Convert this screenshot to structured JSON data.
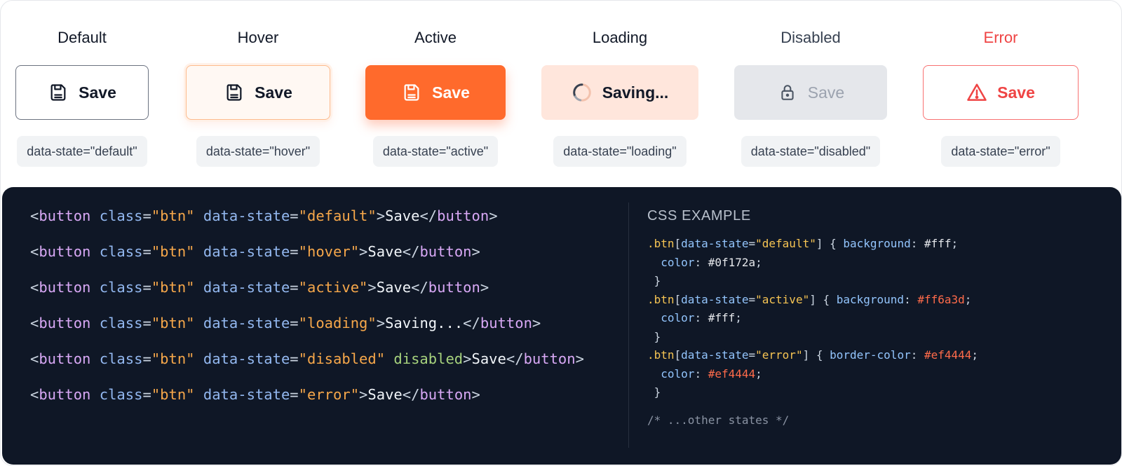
{
  "states": [
    {
      "key": "default",
      "title": "Default",
      "label": "Save",
      "chip": "data-state=\"default\"",
      "icon": "save-icon"
    },
    {
      "key": "hover",
      "title": "Hover",
      "label": "Save",
      "chip": "data-state=\"hover\"",
      "icon": "save-icon"
    },
    {
      "key": "active",
      "title": "Active",
      "label": "Save",
      "chip": "data-state=\"active\"",
      "icon": "save-icon"
    },
    {
      "key": "loading",
      "title": "Loading",
      "label": "Saving...",
      "chip": "data-state=\"loading\"",
      "icon": "spinner-icon"
    },
    {
      "key": "disabled",
      "title": "Disabled",
      "label": "Save",
      "chip": "data-state=\"disabled\"",
      "icon": "lock-icon"
    },
    {
      "key": "error",
      "title": "Error",
      "label": "Save",
      "chip": "data-state=\"error\"",
      "icon": "warning-icon"
    }
  ],
  "colors": {
    "accent": "#ff6a3d",
    "error": "#ef4444",
    "code_bg": "#0f172a"
  },
  "code": {
    "html_lines": [
      [
        {
          "t": "<",
          "c": "punct"
        },
        {
          "t": "button",
          "c": "tag"
        },
        {
          "t": " ",
          "c": "punct"
        },
        {
          "t": "class",
          "c": "attr"
        },
        {
          "t": "=",
          "c": "punct"
        },
        {
          "t": "\"btn\"",
          "c": "str"
        },
        {
          "t": " ",
          "c": "punct"
        },
        {
          "t": "data-state",
          "c": "attr"
        },
        {
          "t": "=",
          "c": "punct"
        },
        {
          "t": "\"default\"",
          "c": "str"
        },
        {
          "t": ">",
          "c": "punct"
        },
        {
          "t": "Save",
          "c": "text"
        },
        {
          "t": "</",
          "c": "punct"
        },
        {
          "t": "button",
          "c": "tag"
        },
        {
          "t": ">",
          "c": "punct"
        }
      ],
      [
        {
          "t": "<",
          "c": "punct"
        },
        {
          "t": "button",
          "c": "tag"
        },
        {
          "t": " ",
          "c": "punct"
        },
        {
          "t": "class",
          "c": "attr"
        },
        {
          "t": "=",
          "c": "punct"
        },
        {
          "t": "\"btn\"",
          "c": "str"
        },
        {
          "t": " ",
          "c": "punct"
        },
        {
          "t": "data-state",
          "c": "attr"
        },
        {
          "t": "=",
          "c": "punct"
        },
        {
          "t": "\"hover\"",
          "c": "str"
        },
        {
          "t": ">",
          "c": "punct"
        },
        {
          "t": "Save",
          "c": "text"
        },
        {
          "t": "</",
          "c": "punct"
        },
        {
          "t": "button",
          "c": "tag"
        },
        {
          "t": ">",
          "c": "punct"
        }
      ],
      [
        {
          "t": "<",
          "c": "punct"
        },
        {
          "t": "button",
          "c": "tag"
        },
        {
          "t": " ",
          "c": "punct"
        },
        {
          "t": "class",
          "c": "attr"
        },
        {
          "t": "=",
          "c": "punct"
        },
        {
          "t": "\"btn\"",
          "c": "str"
        },
        {
          "t": " ",
          "c": "punct"
        },
        {
          "t": "data-state",
          "c": "attr"
        },
        {
          "t": "=",
          "c": "punct"
        },
        {
          "t": "\"active\"",
          "c": "str"
        },
        {
          "t": ">",
          "c": "punct"
        },
        {
          "t": "Save",
          "c": "text"
        },
        {
          "t": "</",
          "c": "punct"
        },
        {
          "t": "button",
          "c": "tag"
        },
        {
          "t": ">",
          "c": "punct"
        }
      ],
      [
        {
          "t": "<",
          "c": "punct"
        },
        {
          "t": "button",
          "c": "tag"
        },
        {
          "t": " ",
          "c": "punct"
        },
        {
          "t": "class",
          "c": "attr"
        },
        {
          "t": "=",
          "c": "punct"
        },
        {
          "t": "\"btn\"",
          "c": "str"
        },
        {
          "t": " ",
          "c": "punct"
        },
        {
          "t": "data-state",
          "c": "attr"
        },
        {
          "t": "=",
          "c": "punct"
        },
        {
          "t": "\"loading\"",
          "c": "str"
        },
        {
          "t": ">",
          "c": "punct"
        },
        {
          "t": "Saving...",
          "c": "text"
        },
        {
          "t": "</",
          "c": "punct"
        },
        {
          "t": "button",
          "c": "tag"
        },
        {
          "t": ">",
          "c": "punct"
        }
      ],
      [
        {
          "t": "<",
          "c": "punct"
        },
        {
          "t": "button",
          "c": "tag"
        },
        {
          "t": " ",
          "c": "punct"
        },
        {
          "t": "class",
          "c": "attr"
        },
        {
          "t": "=",
          "c": "punct"
        },
        {
          "t": "\"btn\"",
          "c": "str"
        },
        {
          "t": " ",
          "c": "punct"
        },
        {
          "t": "data-state",
          "c": "attr"
        },
        {
          "t": "=",
          "c": "punct"
        },
        {
          "t": "\"disabled\"",
          "c": "str"
        },
        {
          "t": " ",
          "c": "punct"
        },
        {
          "t": "disabled",
          "c": "flag"
        },
        {
          "t": ">",
          "c": "punct"
        },
        {
          "t": "Save",
          "c": "text"
        },
        {
          "t": "</",
          "c": "punct"
        },
        {
          "t": "button",
          "c": "tag"
        },
        {
          "t": ">",
          "c": "punct"
        }
      ],
      [
        {
          "t": "<",
          "c": "punct"
        },
        {
          "t": "button",
          "c": "tag"
        },
        {
          "t": " ",
          "c": "punct"
        },
        {
          "t": "class",
          "c": "attr"
        },
        {
          "t": "=",
          "c": "punct"
        },
        {
          "t": "\"btn\"",
          "c": "str"
        },
        {
          "t": " ",
          "c": "punct"
        },
        {
          "t": "data-state",
          "c": "attr"
        },
        {
          "t": "=",
          "c": "punct"
        },
        {
          "t": "\"error\"",
          "c": "str"
        },
        {
          "t": ">",
          "c": "punct"
        },
        {
          "t": "Save",
          "c": "text"
        },
        {
          "t": "</",
          "c": "punct"
        },
        {
          "t": "button",
          "c": "tag"
        },
        {
          "t": ">",
          "c": "punct"
        }
      ]
    ],
    "css_heading": "CSS EXAMPLE",
    "css_lines": [
      [
        {
          "t": ".btn",
          "c": "sel"
        },
        {
          "t": "[",
          "c": "punct"
        },
        {
          "t": "data-state",
          "c": "prop"
        },
        {
          "t": "=",
          "c": "punct"
        },
        {
          "t": "\"default\"",
          "c": "sel"
        },
        {
          "t": "] { ",
          "c": "punct"
        },
        {
          "t": "background",
          "c": "prop"
        },
        {
          "t": ": ",
          "c": "punct"
        },
        {
          "t": "#fff",
          "c": "val"
        },
        {
          "t": ";",
          "c": "punct"
        }
      ],
      [
        {
          "t": "  ",
          "c": "punct"
        },
        {
          "t": "color",
          "c": "prop"
        },
        {
          "t": ": ",
          "c": "punct"
        },
        {
          "t": "#0f172a",
          "c": "val"
        },
        {
          "t": ";",
          "c": "punct"
        }
      ],
      [
        {
          "t": " }",
          "c": "punct"
        }
      ],
      [
        {
          "t": ".btn",
          "c": "sel"
        },
        {
          "t": "[",
          "c": "punct"
        },
        {
          "t": "data-state",
          "c": "prop"
        },
        {
          "t": "=",
          "c": "punct"
        },
        {
          "t": "\"active\"",
          "c": "sel"
        },
        {
          "t": "] { ",
          "c": "punct"
        },
        {
          "t": "background",
          "c": "prop"
        },
        {
          "t": ": ",
          "c": "punct"
        },
        {
          "t": "#ff6a3d",
          "c": "hot"
        },
        {
          "t": ";",
          "c": "punct"
        }
      ],
      [
        {
          "t": "  ",
          "c": "punct"
        },
        {
          "t": "color",
          "c": "prop"
        },
        {
          "t": ": ",
          "c": "punct"
        },
        {
          "t": "#fff",
          "c": "val"
        },
        {
          "t": ";",
          "c": "punct"
        }
      ],
      [
        {
          "t": " }",
          "c": "punct"
        }
      ],
      [
        {
          "t": ".btn",
          "c": "sel"
        },
        {
          "t": "[",
          "c": "punct"
        },
        {
          "t": "data-state",
          "c": "prop"
        },
        {
          "t": "=",
          "c": "punct"
        },
        {
          "t": "\"error\"",
          "c": "sel"
        },
        {
          "t": "] { ",
          "c": "punct"
        },
        {
          "t": "border-color",
          "c": "prop"
        },
        {
          "t": ": ",
          "c": "punct"
        },
        {
          "t": "#ef4444",
          "c": "hot"
        },
        {
          "t": ";",
          "c": "punct"
        }
      ],
      [
        {
          "t": "  ",
          "c": "punct"
        },
        {
          "t": "color",
          "c": "prop"
        },
        {
          "t": ": ",
          "c": "punct"
        },
        {
          "t": "#ef4444",
          "c": "hot"
        },
        {
          "t": ";",
          "c": "punct"
        }
      ],
      [
        {
          "t": " }",
          "c": "punct"
        }
      ]
    ],
    "css_comment": "/* ...other states */"
  }
}
